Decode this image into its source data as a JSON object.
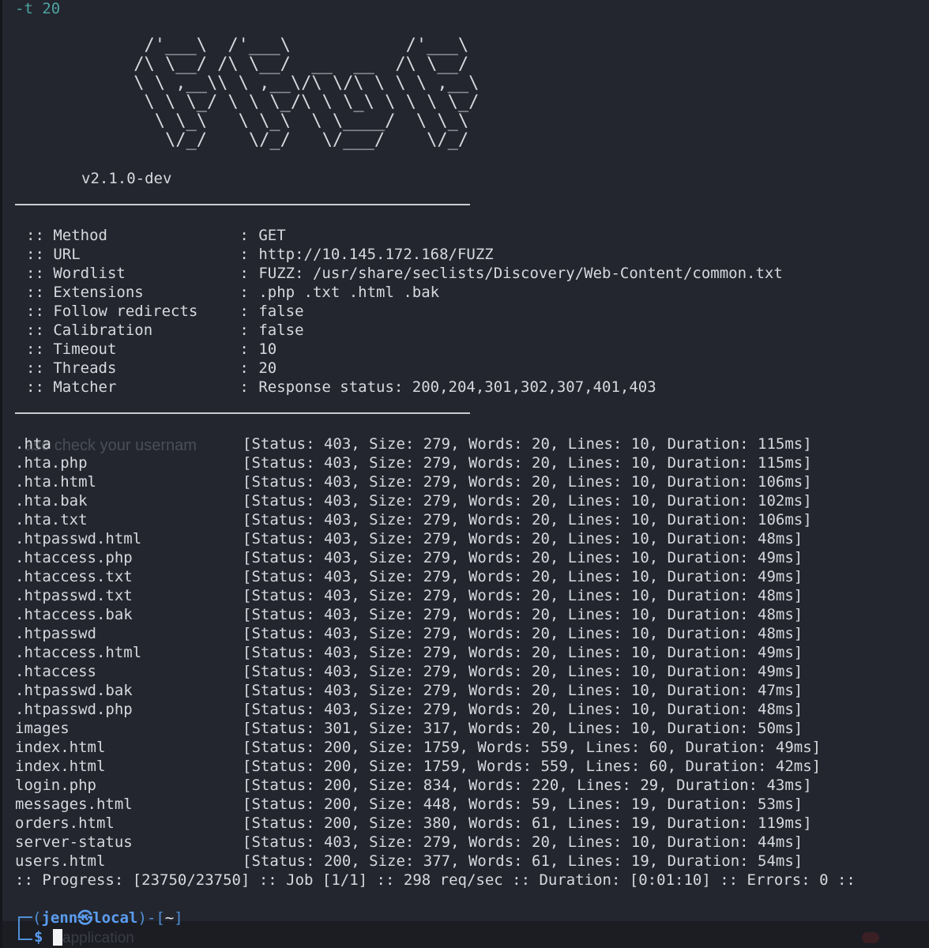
{
  "window": {
    "command_tail": "-t 20"
  },
  "banner": {
    "ascii": "      /'___\\  /'___\\           /'___\\\n     /\\ \\__/ /\\ \\__/  __  __  /\\ \\__/\n     \\ \\ ,__\\\\ \\ ,__\\/\\ \\/\\ \\ \\ \\ ,__\\\n      \\ \\ \\_/ \\ \\ \\_/\\ \\ \\_\\ \\ \\ \\ \\_/\n       \\ \\_\\   \\ \\_\\  \\ \\____/  \\ \\_\\\n        \\/_/    \\/_/   \\/___/    \\/_/",
    "version": "v2.1.0-dev"
  },
  "config": [
    {
      "key": "Method",
      "value": "GET"
    },
    {
      "key": "URL",
      "value": "http://10.145.172.168/FUZZ"
    },
    {
      "key": "Wordlist",
      "value": "FUZZ: /usr/share/seclists/Discovery/Web-Content/common.txt"
    },
    {
      "key": "Extensions",
      "value": ".php .txt .html .bak"
    },
    {
      "key": "Follow redirects",
      "value": "false"
    },
    {
      "key": "Calibration",
      "value": "false"
    },
    {
      "key": "Timeout",
      "value": "10"
    },
    {
      "key": "Threads",
      "value": "20"
    },
    {
      "key": "Matcher",
      "value": "Response status: 200,204,301,302,307,401,403"
    }
  ],
  "results": [
    {
      "name": ".hta",
      "info": "[Status: 403, Size: 279, Words: 20, Lines: 10, Duration: 115ms]"
    },
    {
      "name": ".hta.php",
      "info": "[Status: 403, Size: 279, Words: 20, Lines: 10, Duration: 115ms]"
    },
    {
      "name": ".hta.html",
      "info": "[Status: 403, Size: 279, Words: 20, Lines: 10, Duration: 106ms]"
    },
    {
      "name": ".hta.bak",
      "info": "[Status: 403, Size: 279, Words: 20, Lines: 10, Duration: 102ms]"
    },
    {
      "name": ".hta.txt",
      "info": "[Status: 403, Size: 279, Words: 20, Lines: 10, Duration: 106ms]"
    },
    {
      "name": ".htpasswd.html",
      "info": "[Status: 403, Size: 279, Words: 20, Lines: 10, Duration: 48ms]"
    },
    {
      "name": ".htaccess.php",
      "info": "[Status: 403, Size: 279, Words: 20, Lines: 10, Duration: 49ms]"
    },
    {
      "name": ".htaccess.txt",
      "info": "[Status: 403, Size: 279, Words: 20, Lines: 10, Duration: 49ms]"
    },
    {
      "name": ".htpasswd.txt",
      "info": "[Status: 403, Size: 279, Words: 20, Lines: 10, Duration: 48ms]"
    },
    {
      "name": ".htaccess.bak",
      "info": "[Status: 403, Size: 279, Words: 20, Lines: 10, Duration: 48ms]"
    },
    {
      "name": ".htpasswd",
      "info": "[Status: 403, Size: 279, Words: 20, Lines: 10, Duration: 48ms]"
    },
    {
      "name": ".htaccess.html",
      "info": "[Status: 403, Size: 279, Words: 20, Lines: 10, Duration: 49ms]"
    },
    {
      "name": ".htaccess",
      "info": "[Status: 403, Size: 279, Words: 20, Lines: 10, Duration: 49ms]"
    },
    {
      "name": ".htpasswd.bak",
      "info": "[Status: 403, Size: 279, Words: 20, Lines: 10, Duration: 47ms]"
    },
    {
      "name": ".htpasswd.php",
      "info": "[Status: 403, Size: 279, Words: 20, Lines: 10, Duration: 48ms]"
    },
    {
      "name": "images",
      "info": "[Status: 301, Size: 317, Words: 20, Lines: 10, Duration: 50ms]"
    },
    {
      "name": "index.html",
      "info": "[Status: 200, Size: 1759, Words: 559, Lines: 60, Duration: 49ms]"
    },
    {
      "name": "index.html",
      "info": "[Status: 200, Size: 1759, Words: 559, Lines: 60, Duration: 42ms]"
    },
    {
      "name": "login.php",
      "info": "[Status: 200, Size: 834, Words: 220, Lines: 29, Duration: 43ms]"
    },
    {
      "name": "messages.html",
      "info": "[Status: 200, Size: 448, Words: 59, Lines: 19, Duration: 53ms]"
    },
    {
      "name": "orders.html",
      "info": "[Status: 200, Size: 380, Words: 61, Lines: 19, Duration: 119ms]"
    },
    {
      "name": "server-status",
      "info": "[Status: 403, Size: 279, Words: 20, Lines: 10, Duration: 44ms]"
    },
    {
      "name": "users.html",
      "info": "[Status: 200, Size: 377, Words: 61, Lines: 19, Duration: 54ms]"
    }
  ],
  "progress": ":: Progress: [23750/23750] :: Job [1/1] :: 298 req/sec :: Duration: [0:01:10] :: Errors: 0 ::",
  "ghost_text": {
    "behind_results": "ase check your usernam",
    "behind_prompt": "application"
  },
  "prompt": {
    "open": "(",
    "user": "jenn",
    "at": "㉿",
    "host": "local",
    "mid": ")-[",
    "dir": "~",
    "close": "]",
    "symbol": "$"
  },
  "colors": {
    "background": "#23262f",
    "text": "#d6d9de",
    "prompt_blue": "#5b9df0",
    "flag_teal": "#4da3a0"
  }
}
